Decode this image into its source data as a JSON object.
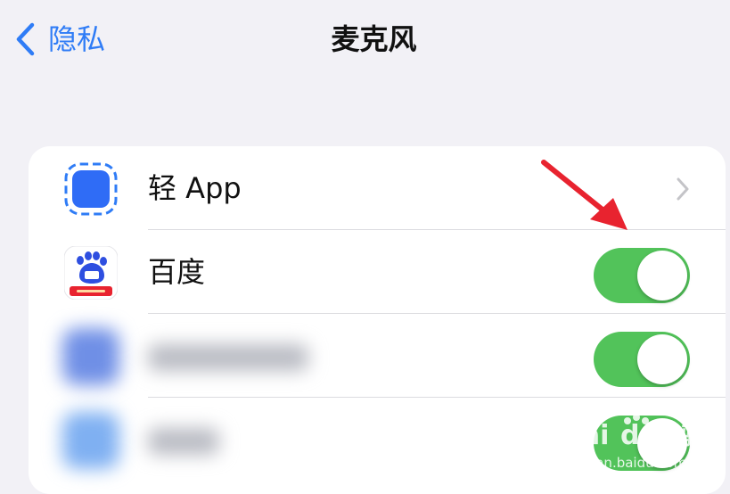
{
  "nav": {
    "back_label": "隐私",
    "title": "麦克风"
  },
  "rows": [
    {
      "label": "轻 App",
      "accessory": "chevron"
    },
    {
      "label": "百度",
      "accessory": "toggle",
      "toggle_on": true
    },
    {
      "label": "",
      "accessory": "toggle",
      "toggle_on": true,
      "blurred": true
    },
    {
      "label": "",
      "accessory": "toggle",
      "toggle_on": true,
      "blurred": true
    }
  ],
  "watermark": {
    "brand": "Baidu经验",
    "url": "jingyan.baidu.com"
  },
  "colors": {
    "background": "#f2f1f6",
    "accent": "#2f7cf6",
    "toggle_on": "#52c35a",
    "annotation_arrow": "#e8232f"
  },
  "icons": {
    "back": "chevron-left-icon",
    "light_app": "light-app-icon",
    "baidu": "baidu-paw-icon",
    "disclosure": "chevron-right-icon"
  }
}
